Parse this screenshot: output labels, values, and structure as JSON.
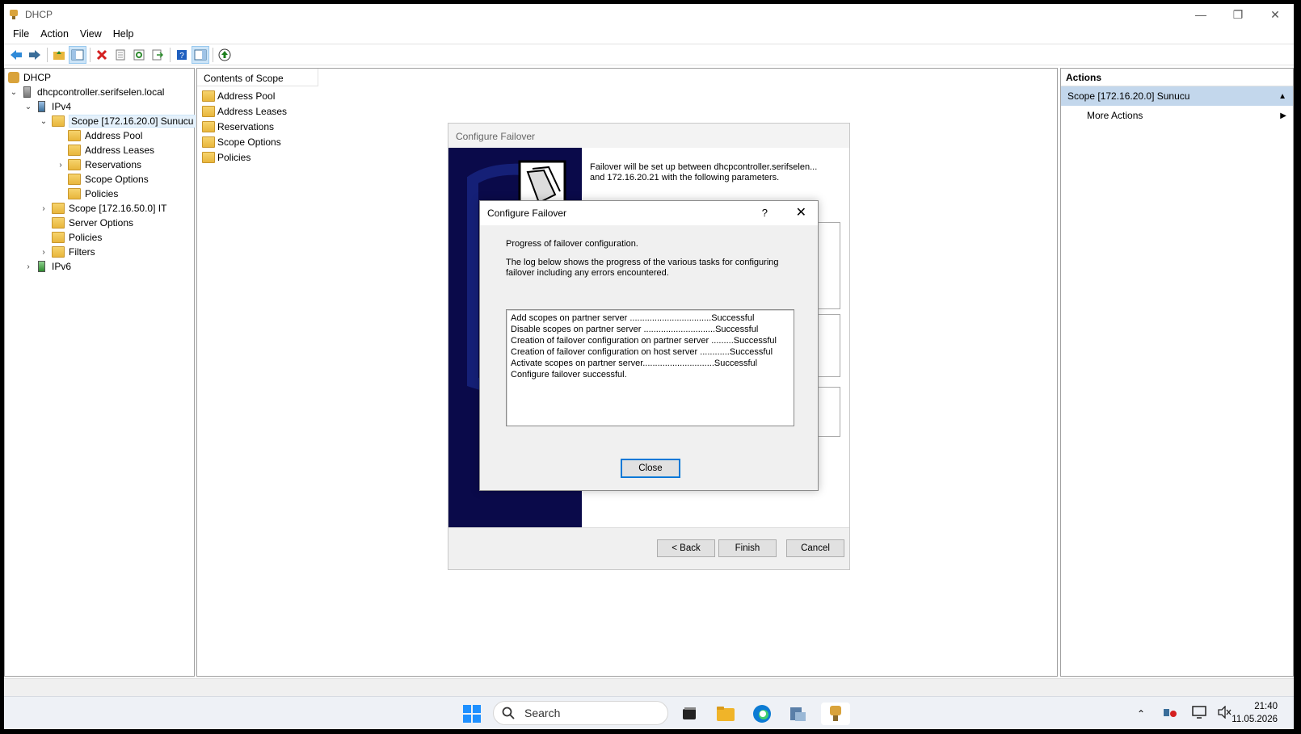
{
  "window": {
    "title": "DHCP"
  },
  "menu": [
    "File",
    "Action",
    "View",
    "Help"
  ],
  "tree": {
    "root": "DHCP",
    "server": "dhcpcontroller.serifselen.local",
    "ipv4": "IPv4",
    "scope1": "Scope [172.16.20.0] Sunucu",
    "scope1_children": [
      "Address Pool",
      "Address Leases",
      "Reservations",
      "Scope Options",
      "Policies"
    ],
    "scope2": "Scope [172.16.50.0] IT",
    "server_options": "Server Options",
    "policies": "Policies",
    "filters": "Filters",
    "ipv6": "IPv6"
  },
  "content": {
    "header": "Contents of Scope",
    "items": [
      "Address Pool",
      "Address Leases",
      "Reservations",
      "Scope Options",
      "Policies"
    ]
  },
  "actions": {
    "title": "Actions",
    "selected": "Scope [172.16.20.0] Sunucu",
    "more": "More Actions"
  },
  "wizard": {
    "title": "Configure Failover",
    "intro": "Failover will be set up between dhcpcontroller.serifselen... and 172.16.20.21 with the following parameters.",
    "back": "< Back",
    "finish": "Finish",
    "cancel": "Cancel"
  },
  "progress": {
    "title": "Configure Failover",
    "help": "?",
    "heading": "Progress of failover configuration.",
    "description": "The log below shows the progress of the various tasks for configuring failover including any errors encountered.",
    "log": [
      "Add scopes on partner server .................................Successful",
      "Disable scopes on partner server .............................Successful",
      "Creation of failover configuration on partner server .........Successful",
      "Creation of failover configuration on host server ............Successful",
      "Activate scopes on partner server.............................Successful",
      "Configure failover successful."
    ],
    "close": "Close"
  },
  "taskbar": {
    "search_placeholder": "Search",
    "time": "21:40",
    "date": "11.05.2026"
  }
}
